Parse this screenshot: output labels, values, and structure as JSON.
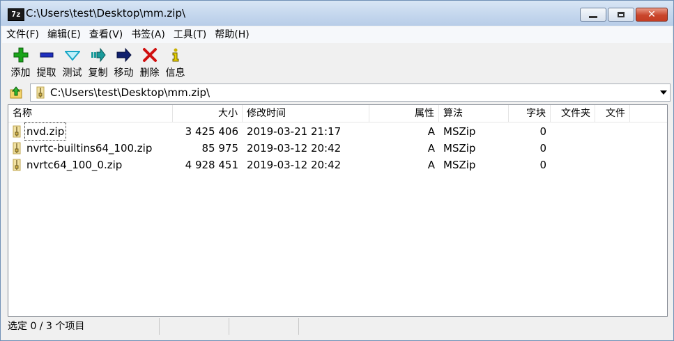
{
  "window": {
    "title": "C:\\Users\\test\\Desktop\\mm.zip\\",
    "app_icon_text": "7z",
    "minimize_icon": "minimize-icon",
    "maximize_icon": "maximize-icon",
    "close_icon": "close-icon"
  },
  "menu": [
    "文件(F)",
    "编辑(E)",
    "查看(V)",
    "书签(A)",
    "工具(T)",
    "帮助(H)"
  ],
  "toolbar": [
    {
      "label": "添加",
      "icon": "add-icon",
      "color": "#1aa51a"
    },
    {
      "label": "提取",
      "icon": "extract-icon",
      "color": "#1f2fbf"
    },
    {
      "label": "测试",
      "icon": "test-icon",
      "color": "#18a7c6"
    },
    {
      "label": "复制",
      "icon": "copy-icon",
      "color": "#1a9a9a"
    },
    {
      "label": "移动",
      "icon": "move-icon",
      "color": "#10206e"
    },
    {
      "label": "删除",
      "icon": "delete-icon",
      "color": "#d01010"
    },
    {
      "label": "信息",
      "icon": "info-icon",
      "color": "#c9b000"
    }
  ],
  "address": {
    "path": "C:\\Users\\test\\Desktop\\mm.zip\\",
    "up_icon": "up-folder-icon",
    "dropdown_icon": "dropdown-arrow-icon"
  },
  "columns": [
    "名称",
    "大小",
    "修改时间",
    "属性",
    "算法",
    "字块",
    "文件夹",
    "文件"
  ],
  "files": [
    {
      "name": "nvd.zip",
      "size": "3 425 406",
      "modified": "2019-03-21 21:17",
      "attr": "A",
      "method": "MSZip",
      "block": "0",
      "folders": "",
      "files": ""
    },
    {
      "name": "nvrtc-builtins64_100.zip",
      "size": "85 975",
      "modified": "2019-03-12 20:42",
      "attr": "A",
      "method": "MSZip",
      "block": "0",
      "folders": "",
      "files": ""
    },
    {
      "name": "nvrtc64_100_0.zip",
      "size": "4 928 451",
      "modified": "2019-03-12 20:42",
      "attr": "A",
      "method": "MSZip",
      "block": "0",
      "folders": "",
      "files": ""
    }
  ],
  "status": [
    "选定 0 / 3 个项目",
    "",
    "",
    ""
  ]
}
